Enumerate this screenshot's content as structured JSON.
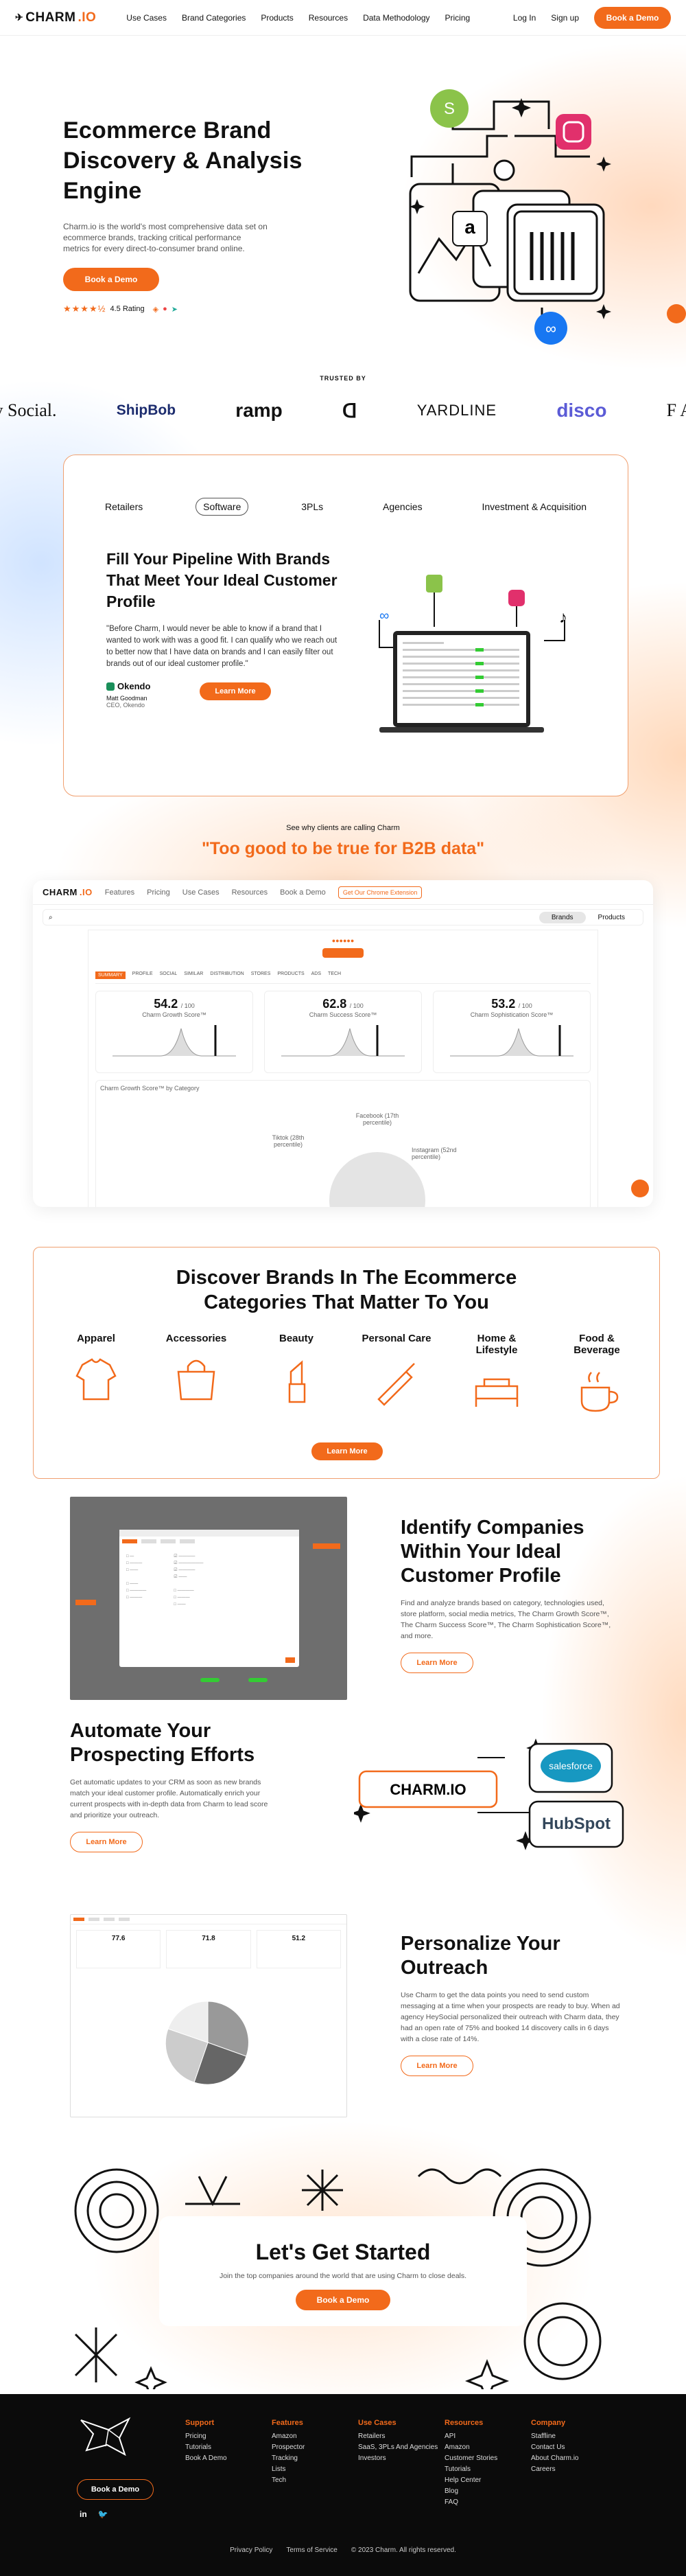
{
  "nav": {
    "logo_a": "CHARM",
    "logo_b": ".IO",
    "links": [
      "Use Cases",
      "Brand Categories",
      "Products",
      "Resources",
      "Data Methodology",
      "Pricing"
    ],
    "login": "Log In",
    "signup": "Sign up",
    "cta": "Book a Demo"
  },
  "hero": {
    "title": "Ecommerce Brand Discovery & Analysis Engine",
    "desc": "Charm.io is the world's most comprehensive data set on ecommerce brands, tracking critical performance metrics for every direct-to-consumer brand online.",
    "cta": "Book a Demo",
    "rating": "4.5 Rating",
    "stars": "★★★★½"
  },
  "trusted": {
    "label": "TRUSTED BY",
    "logos": [
      "ey Social.",
      "ShipBob",
      "ramp",
      "ᗡ",
      "YARDLINE",
      "disco",
      "F A"
    ]
  },
  "tabs": {
    "items": [
      "Retailers",
      "Software",
      "3PLs",
      "Agencies",
      "Investment & Acquisition"
    ],
    "active": 1
  },
  "pipeline": {
    "title": "Fill Your Pipeline With Brands That Meet Your Ideal Customer Profile",
    "quote": "\"Before Charm, I would never be able to know if a brand that I wanted to work with was a good fit. I can qualify who we reach out to better now that I have data on brands and I can easily filter out brands out of our ideal customer profile.\"",
    "company": "Okendo",
    "person": "Matt Goodman",
    "role": "CEO, Okendo",
    "cta": "Learn More"
  },
  "clients": {
    "sub": "See why clients are calling Charm",
    "quote": "\"Too good to be true for B2B data\""
  },
  "app": {
    "menu": [
      "Features",
      "Pricing",
      "Use Cases",
      "Resources",
      "Book a Demo"
    ],
    "chrome": "Get Our Chrome Extension",
    "toggle_a": "Brands",
    "toggle_b": "Products",
    "subtabs": [
      "SUMMARY",
      "PROFILE",
      "SOCIAL",
      "SIMILAR",
      "DISTRIBUTION",
      "STORES",
      "PRODUCTS",
      "ADS",
      "TECH"
    ],
    "scores": [
      {
        "v": "54.2",
        "d": "/ 100",
        "l": "Charm Growth Score™"
      },
      {
        "v": "62.8",
        "d": "/ 100",
        "l": "Charm Success Score™"
      },
      {
        "v": "53.2",
        "d": "/ 100",
        "l": "Charm Sophistication Score™"
      }
    ],
    "chart_title": "Charm Growth Score™ by Category",
    "pie_labels": [
      "Facebook (17th percentile)",
      "Tiktok (28th percentile)",
      "Instagram (52nd percentile)"
    ]
  },
  "cats": {
    "title": "Discover Brands In The Ecommerce Categories That Matter To You",
    "items": [
      "Apparel",
      "Accessories",
      "Beauty",
      "Personal Care",
      "Home & Lifestyle",
      "Food & Beverage"
    ],
    "cta": "Learn More"
  },
  "identify": {
    "title": "Identify Companies Within Your Ideal Customer Profile",
    "desc": "Find and analyze brands based on category, technologies used, store platform, social media metrics, The Charm Growth Score™, The Charm Success Score™, The Charm Sophistication Score™, and more.",
    "cta": "Learn More"
  },
  "automate": {
    "title": "Automate Your Prospecting Efforts",
    "desc": "Get automatic updates to your CRM as soon as new brands match your ideal customer profile. Automatically enrich your current prospects with in-depth data from Charm to lead score and prioritize your outreach.",
    "cta": "Learn More",
    "salesforce": "salesforce",
    "hubspot": "HubSpot"
  },
  "personal": {
    "title": "Personalize Your Outreach",
    "desc": "Use Charm to get the data points you need to send custom messaging at a time when your prospects are ready to buy. When ad agency HeySocial personalized their outreach with Charm data, they had an open rate of 75% and booked 14 discovery calls in 6 days with a close rate of 14%.",
    "cta": "Learn More",
    "scores": [
      "77.6",
      "71.8",
      "51.2"
    ]
  },
  "start": {
    "title": "Let's Get Started",
    "desc": "Join the top companies around the world that are using Charm to close deals.",
    "cta": "Book a Demo"
  },
  "footer": {
    "cta": "Book a Demo",
    "cols": [
      {
        "t": "Support",
        "i": [
          "Pricing",
          "Tutorials",
          "Book A Demo"
        ]
      },
      {
        "t": "Features",
        "i": [
          "Amazon",
          "Prospector",
          "Tracking",
          "Lists",
          "Tech"
        ]
      },
      {
        "t": "Use Cases",
        "i": [
          "Retailers",
          "SaaS, 3PLs And Agencies",
          "Investors"
        ]
      },
      {
        "t": "Resources",
        "i": [
          "API",
          "Amazon",
          "Customer Stories",
          "Tutorials",
          "Help Center",
          "Blog",
          "FAQ"
        ]
      },
      {
        "t": "Company",
        "i": [
          "Staffline",
          "Contact Us",
          "About Charm.io",
          "Careers"
        ]
      }
    ],
    "privacy": "Privacy Policy",
    "terms": "Terms of Service",
    "copy": "© 2023 Charm. All rights reserved."
  }
}
